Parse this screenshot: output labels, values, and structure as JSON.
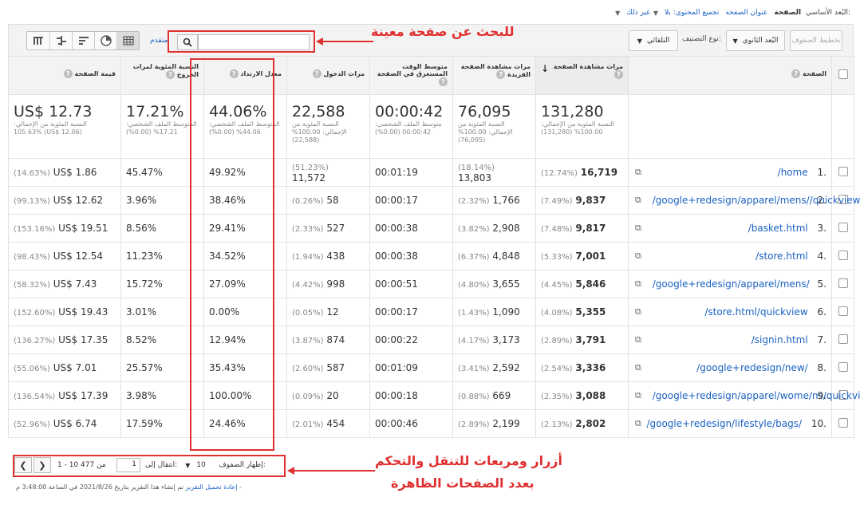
{
  "nav": {
    "label": "البُعد الأساسي:",
    "current": "الصفحة",
    "links": [
      "عنوان الصفحة",
      "تجميع المحتوى: بلا",
      "غير ذلك"
    ]
  },
  "toolbar": {
    "plot_rows": "تخطيط الصفوف",
    "secondary_dim": "البُعد الثانوي",
    "sort_type_label": "نوع التصنيف:",
    "sort_type_value": "التلقائي",
    "advanced": "متقدم",
    "search_placeholder": ""
  },
  "columns": [
    {
      "label": "الصفحة"
    },
    {
      "label": "مرات مشاهدة الصفحة"
    },
    {
      "label": "مرات مشاهدة الصفحة الفريدة"
    },
    {
      "label": "متوسط الوقت المستغرق في الصفحة"
    },
    {
      "label": "مرات الدخول"
    },
    {
      "label": "معدل الارتداد"
    },
    {
      "label": "النسبة المئوية لمرات الخروج"
    },
    {
      "label": "قيمة الصفحة"
    }
  ],
  "totals": [
    {
      "big": "131,280",
      "sub": "النسبة المئوية من الإجمالي: 100.00% (131,280)"
    },
    {
      "big": "76,095",
      "sub": "النسبة المئوية من الإجمالي: 100.00% (76,095)"
    },
    {
      "big": "00:00:42",
      "sub": "متوسط الملف الشخصي: 00:00:42 (0.00%)"
    },
    {
      "big": "22,588",
      "sub": "النسبة المئوية من الإجمالي: 100.00% (22,588)"
    },
    {
      "big": "44.06%",
      "sub": "المتوسط الملف الشخصي: 44.06% (0.00%)"
    },
    {
      "big": "17.21%",
      "sub": "المتوسط الملف الشخصي: 17.21% (0.00%)"
    },
    {
      "big": "US$ 12.73",
      "sub": "النسبة المئوية من الإجمالي: 105.63% (US$ 12.06)"
    }
  ],
  "rows": [
    {
      "idx": "1.",
      "page": "/home",
      "pv": "16,719",
      "pvp": "(12.74%)",
      "upv": "13,803",
      "upvp": "(18.14%)",
      "time": "00:01:19",
      "ent": "11,572",
      "entp": "(51.23%)",
      "bounce": "49.92%",
      "exit": "45.47%",
      "val": "US$ 1.86",
      "valp": "(14.63%)"
    },
    {
      "idx": "2.",
      "page": "/google+redesign/apparel/mens//quickview",
      "pv": "9,837",
      "pvp": "(7.49%)",
      "upv": "1,766",
      "upvp": "(2.32%)",
      "time": "00:00:17",
      "ent": "58",
      "entp": "(0.26%)",
      "bounce": "38.46%",
      "exit": "3.96%",
      "val": "US$ 12.62",
      "valp": "(99.13%)"
    },
    {
      "idx": "3.",
      "page": "/basket.html",
      "pv": "9,817",
      "pvp": "(7.48%)",
      "upv": "2,908",
      "upvp": "(3.82%)",
      "time": "00:00:38",
      "ent": "527",
      "entp": "(2.33%)",
      "bounce": "29.41%",
      "exit": "8.56%",
      "val": "US$ 19.51",
      "valp": "(153.16%)"
    },
    {
      "idx": "4.",
      "page": "/store.html",
      "pv": "7,001",
      "pvp": "(5.33%)",
      "upv": "4,848",
      "upvp": "(6.37%)",
      "time": "00:00:38",
      "ent": "438",
      "entp": "(1.94%)",
      "bounce": "34.52%",
      "exit": "11.23%",
      "val": "US$ 12.54",
      "valp": "(98.43%)"
    },
    {
      "idx": "5.",
      "page": "/google+redesign/apparel/mens/",
      "pv": "5,846",
      "pvp": "(4.45%)",
      "upv": "3,655",
      "upvp": "(4.80%)",
      "time": "00:00:51",
      "ent": "998",
      "entp": "(4.42%)",
      "bounce": "27.09%",
      "exit": "15.72%",
      "val": "US$ 7.43",
      "valp": "(58.32%)"
    },
    {
      "idx": "6.",
      "page": "/store.html/quickview",
      "pv": "5,355",
      "pvp": "(4.08%)",
      "upv": "1,090",
      "upvp": "(1.43%)",
      "time": "00:00:17",
      "ent": "12",
      "entp": "(0.05%)",
      "bounce": "0.00%",
      "exit": "3.01%",
      "val": "US$ 19.43",
      "valp": "(152.60%)"
    },
    {
      "idx": "7.",
      "page": "/signin.html",
      "pv": "3,791",
      "pvp": "(2.89%)",
      "upv": "3,173",
      "upvp": "(4.17%)",
      "time": "00:00:22",
      "ent": "874",
      "entp": "(3.87%)",
      "bounce": "12.94%",
      "exit": "8.52%",
      "val": "US$ 17.35",
      "valp": "(136.27%)"
    },
    {
      "idx": "8.",
      "page": "/google+redesign/new/",
      "pv": "3,336",
      "pvp": "(2.54%)",
      "upv": "2,592",
      "upvp": "(3.41%)",
      "time": "00:01:09",
      "ent": "587",
      "entp": "(2.60%)",
      "bounce": "35.43%",
      "exit": "25.57%",
      "val": "US$ 7.01",
      "valp": "(55.06%)"
    },
    {
      "idx": "9.",
      "page": "/google+redesign/apparel/wome/ns/quickview",
      "pv": "3,088",
      "pvp": "(2.35%)",
      "upv": "669",
      "upvp": "(0.88%)",
      "time": "00:00:18",
      "ent": "20",
      "entp": "(0.09%)",
      "bounce": "100.00%",
      "exit": "3.98%",
      "val": "US$ 17.39",
      "valp": "(136.54%)"
    },
    {
      "idx": "10.",
      "page": "/google+redesign/lifestyle/bags/",
      "pv": "2,802",
      "pvp": "(2.13%)",
      "upv": "2,199",
      "upvp": "(2.89%)",
      "time": "00:00:46",
      "ent": "454",
      "entp": "(2.01%)",
      "bounce": "24.46%",
      "exit": "17.59%",
      "val": "US$ 6.74",
      "valp": "(52.96%)"
    }
  ],
  "pager": {
    "show_rows_label": "إظهار الصفوف:",
    "show_rows_value": "10",
    "goto_label": "انتقال إلى:",
    "goto_value": "1",
    "range": "1 - 10 من 477"
  },
  "footer": {
    "generated": "تم إنشاء هذا التقرير بتاريخ 2021/8/26 في الساعة 3:48:00 م - ",
    "reload": "إعادة تحميل التقرير"
  },
  "annotations": {
    "search": "للبحث عن صفحة معينة",
    "pager_line1": "أزرار ومربعات للتنقل والتحكم",
    "pager_line2": "بعدد الصفحات الظاهرة"
  },
  "colors": {
    "highlight": "#e03030",
    "link": "#1a61c2"
  }
}
